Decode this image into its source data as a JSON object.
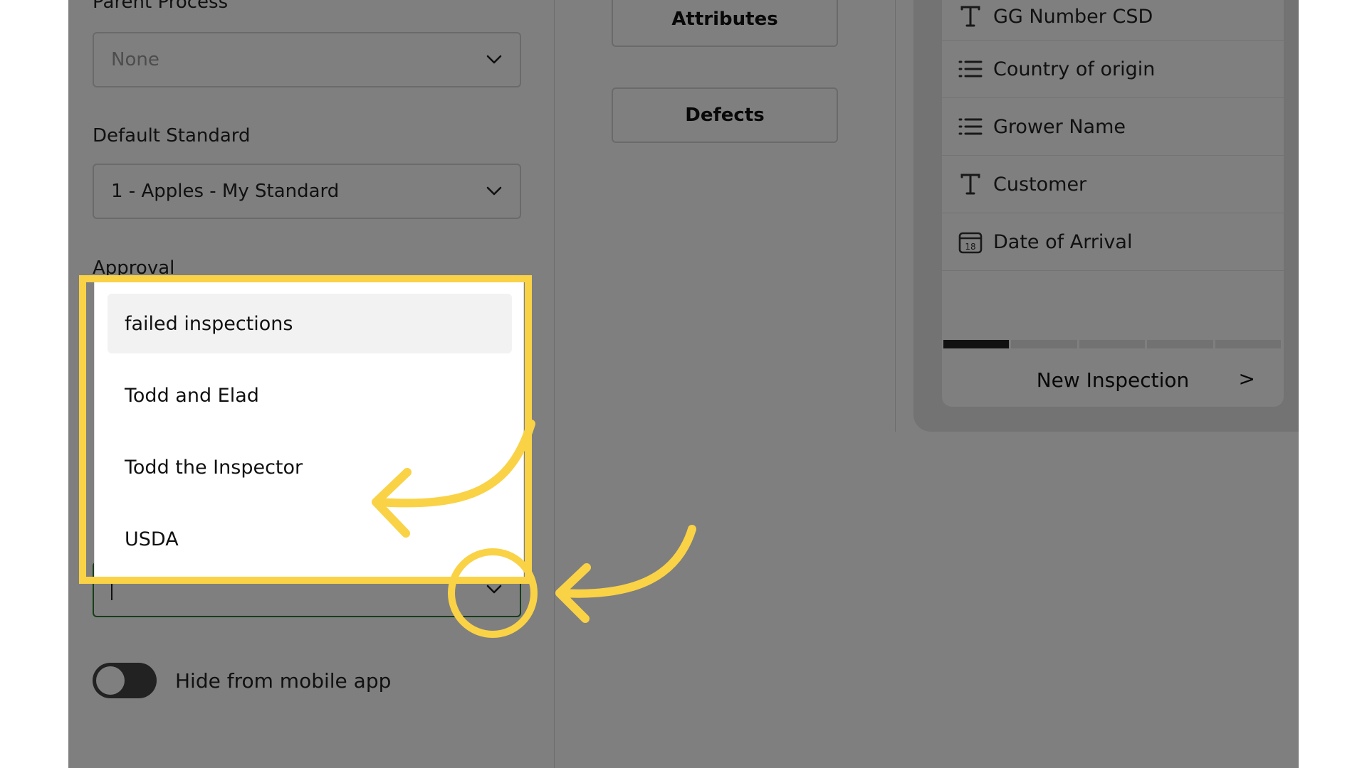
{
  "left_column": {
    "parent_process_label": "Parent Process",
    "parent_process_value": "None",
    "default_standard_label": "Default Standard",
    "default_standard_value": "1 - Apples - My Standard",
    "approval_label": "Approval",
    "approval_input_value": "",
    "hide_toggle_label": "Hide from mobile app",
    "hide_toggle_on": false
  },
  "dropdown": {
    "options": [
      {
        "label": "failed inspections",
        "highlighted": true
      },
      {
        "label": "Todd and Elad",
        "highlighted": false
      },
      {
        "label": "Todd the Inspector",
        "highlighted": false
      },
      {
        "label": "USDA",
        "highlighted": false
      }
    ]
  },
  "middle_column": {
    "attributes_button": "Attributes",
    "defects_button": "Defects"
  },
  "preview_card": {
    "fields": [
      {
        "label": "GG Number CSD",
        "icon": "text-type-icon"
      },
      {
        "label": "Country of origin",
        "icon": "list-icon"
      },
      {
        "label": "Grower Name",
        "icon": "list-icon"
      },
      {
        "label": "Customer",
        "icon": "text-type-icon"
      },
      {
        "label": "Date of Arrival",
        "icon": "calendar-icon"
      }
    ],
    "calendar_day": "18",
    "progress_segments": 5,
    "progress_active": 1,
    "new_inspection_label": "New Inspection",
    "next_glyph": ">"
  },
  "colors": {
    "highlight": "#fad246",
    "focus_border": "#2e7d32",
    "dim_overlay": "rgba(0,0,0,0.5)"
  }
}
